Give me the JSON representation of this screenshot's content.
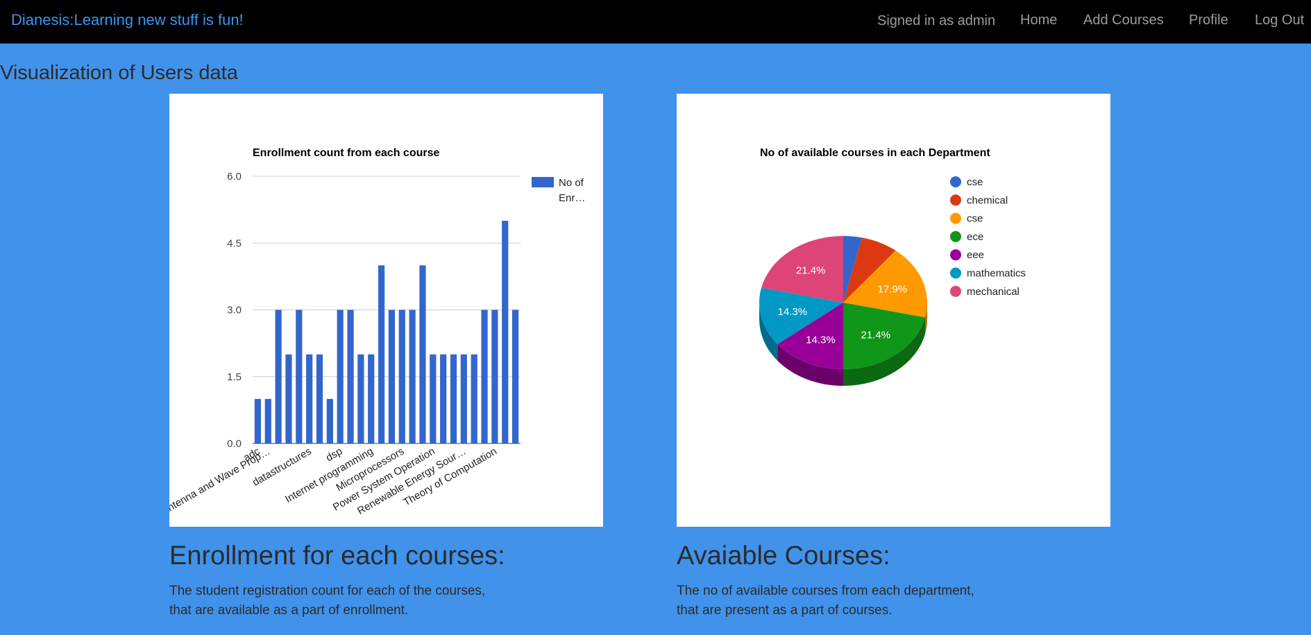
{
  "navbar": {
    "brand": "Dianesis:Learning new stuff is fun!",
    "signed_in": "Signed in as admin",
    "links": [
      "Home",
      "Add Courses",
      "Profile",
      "Log Out"
    ]
  },
  "page": {
    "heading": "Visualization of Users data"
  },
  "sections": [
    {
      "title": "Enrollment for each courses:",
      "desc_line1": "The student registration count for each of the courses,",
      "desc_line2": "that are available as a part of enrollment."
    },
    {
      "title": "Avaiable Courses:",
      "desc_line1": "The no of available courses from each department,",
      "desc_line2": "that are present as a part of courses."
    }
  ],
  "chart_data": [
    {
      "type": "bar",
      "title": "Enrollment count from each course",
      "ylim": [
        0,
        6
      ],
      "yticks": [
        "0.0",
        "1.5",
        "3.0",
        "4.5",
        "6.0"
      ],
      "ytick_values": [
        0,
        1.5,
        3,
        4.5,
        6
      ],
      "values": [
        1,
        1,
        3,
        2,
        3,
        2,
        2,
        1,
        3,
        3,
        2,
        2,
        4,
        3,
        3,
        3,
        4,
        2,
        2,
        2,
        2,
        2,
        3,
        3,
        5,
        3
      ],
      "category_labels": [
        {
          "index": 0,
          "text": "adc"
        },
        {
          "index": 1,
          "text": "Antenna and Wave Prop…"
        },
        {
          "index": 5,
          "text": "datastructures"
        },
        {
          "index": 8,
          "text": "dsp"
        },
        {
          "index": 11,
          "text": "Internet programming"
        },
        {
          "index": 14,
          "text": "Microprocessors"
        },
        {
          "index": 17,
          "text": "Power System Operation"
        },
        {
          "index": 20,
          "text": "Renewable Energy Sour…"
        },
        {
          "index": 23,
          "text": "Theory of Computation"
        }
      ],
      "series": [
        {
          "name": "No of Enr…",
          "legend_line1": "No of",
          "legend_line2": "Enr…",
          "color": "#3366cc"
        }
      ],
      "grid": true,
      "legend": "right"
    },
    {
      "type": "pie",
      "title": "No of available courses in each Department",
      "slices": [
        {
          "label": "cse",
          "value": 1,
          "color": "#3366cc",
          "pct": ""
        },
        {
          "label": "chemical",
          "value": 2,
          "color": "#dc3912",
          "pct": ""
        },
        {
          "label": "cse",
          "value": 5,
          "color": "#ff9900",
          "pct": "17.9%"
        },
        {
          "label": "ece",
          "value": 6,
          "color": "#109618",
          "pct": "21.4%"
        },
        {
          "label": "eee",
          "value": 4,
          "color": "#990099",
          "pct": "14.3%"
        },
        {
          "label": "mathematics",
          "value": 4,
          "color": "#0099c6",
          "pct": "14.3%"
        },
        {
          "label": "mechanical",
          "value": 6,
          "color": "#dd4477",
          "pct": "21.4%"
        }
      ],
      "legend": "right",
      "style": "3d"
    }
  ]
}
